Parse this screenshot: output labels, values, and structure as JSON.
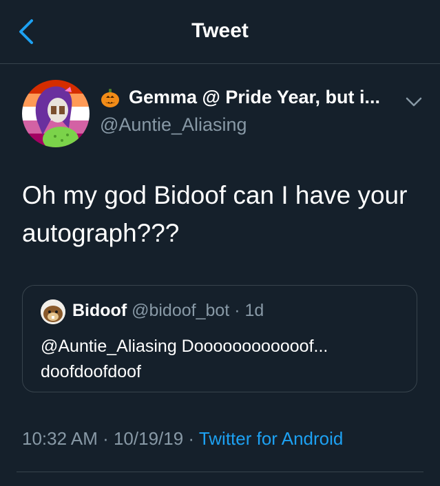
{
  "header": {
    "title": "Tweet",
    "back_icon": "chevron-left-icon"
  },
  "tweet": {
    "author": {
      "display_name": "Gemma @ Pride Year, but i...",
      "handle": "@Auntie_Aliasing",
      "name_emoji": "pumpkin-icon"
    },
    "text": "Oh my god Bidoof can I have your autograph???",
    "quoted": {
      "name": "Bidoof",
      "handle": "@bidoof_bot",
      "separator": " · ",
      "age": "1d",
      "text": "@Auntie_Aliasing Doooooooooooof... doofdoofdoof"
    },
    "meta": {
      "time": "10:32 AM",
      "date": "10/19/19",
      "separator": " · ",
      "source": "Twitter for Android"
    }
  },
  "colors": {
    "background": "#15202b",
    "divider": "#38444d",
    "secondary_text": "#8899a6",
    "accent": "#1da1f2"
  }
}
